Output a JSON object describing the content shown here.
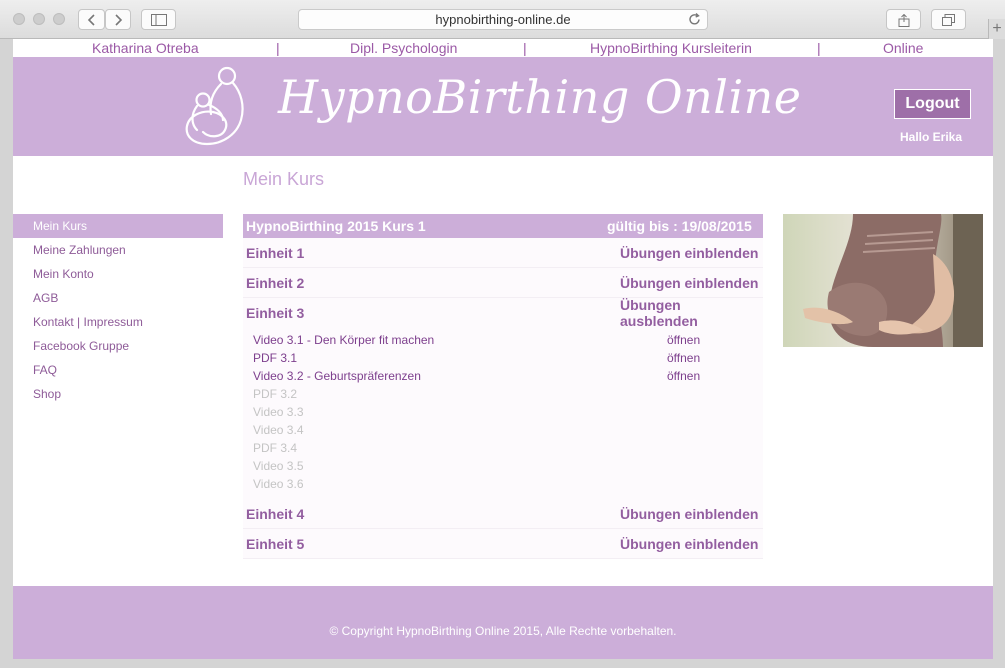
{
  "browser": {
    "url": "hypnobirthing-online.de"
  },
  "topnav": {
    "items": [
      "Katharina Otreba",
      "Dipl. Psychologin",
      "HypnoBirthing Kursleiterin",
      "Online"
    ],
    "separator": "|"
  },
  "header": {
    "site_title": "HypnoBirthing Online",
    "logout_label": "Logout",
    "greeting": "Hallo Erika"
  },
  "page": {
    "title": "Mein Kurs"
  },
  "sidebar": {
    "items": [
      {
        "label": "Mein Kurs",
        "active": true
      },
      {
        "label": "Meine Zahlungen"
      },
      {
        "label": "Mein Konto"
      },
      {
        "label": "AGB"
      },
      {
        "label": "Kontakt | Impressum"
      },
      {
        "label": "Facebook Gruppe"
      },
      {
        "label": "FAQ"
      },
      {
        "label": "Shop"
      }
    ]
  },
  "course": {
    "name": "HypnoBirthing 2015 Kurs 1",
    "valid_until": "gültig bis : 19/08/2015",
    "units": [
      {
        "label": "Einheit 1",
        "toggle": "Übungen einblenden"
      },
      {
        "label": "Einheit 2",
        "toggle": "Übungen einblenden"
      },
      {
        "label": "Einheit 3",
        "toggle": "Übungen ausblenden"
      },
      {
        "label": "Einheit 4",
        "toggle": "Übungen einblenden"
      },
      {
        "label": "Einheit 5",
        "toggle": "Übungen einblenden"
      }
    ],
    "lessons": [
      {
        "name": "Video 3.1 - Den Körper fit machen",
        "action": "öffnen",
        "available": true
      },
      {
        "name": "PDF 3.1",
        "action": "öffnen",
        "available": true
      },
      {
        "name": "Video 3.2 - Geburtspräferenzen",
        "action": "öffnen",
        "available": true
      },
      {
        "name": "PDF 3.2",
        "action": "",
        "available": false
      },
      {
        "name": "Video 3.3",
        "action": "",
        "available": false
      },
      {
        "name": "Video 3.4",
        "action": "",
        "available": false
      },
      {
        "name": "PDF 3.4",
        "action": "",
        "available": false
      },
      {
        "name": "Video 3.5",
        "action": "",
        "available": false
      },
      {
        "name": "Video 3.6",
        "action": "",
        "available": false
      }
    ]
  },
  "footer": {
    "copyright": "© Copyright HypnoBirthing Online 2015, Alle Rechte vorbehalten."
  },
  "colors": {
    "brand_lilac": "#ccaed9",
    "link_purple": "#935ea0",
    "button_purple": "#9e6fa8"
  }
}
